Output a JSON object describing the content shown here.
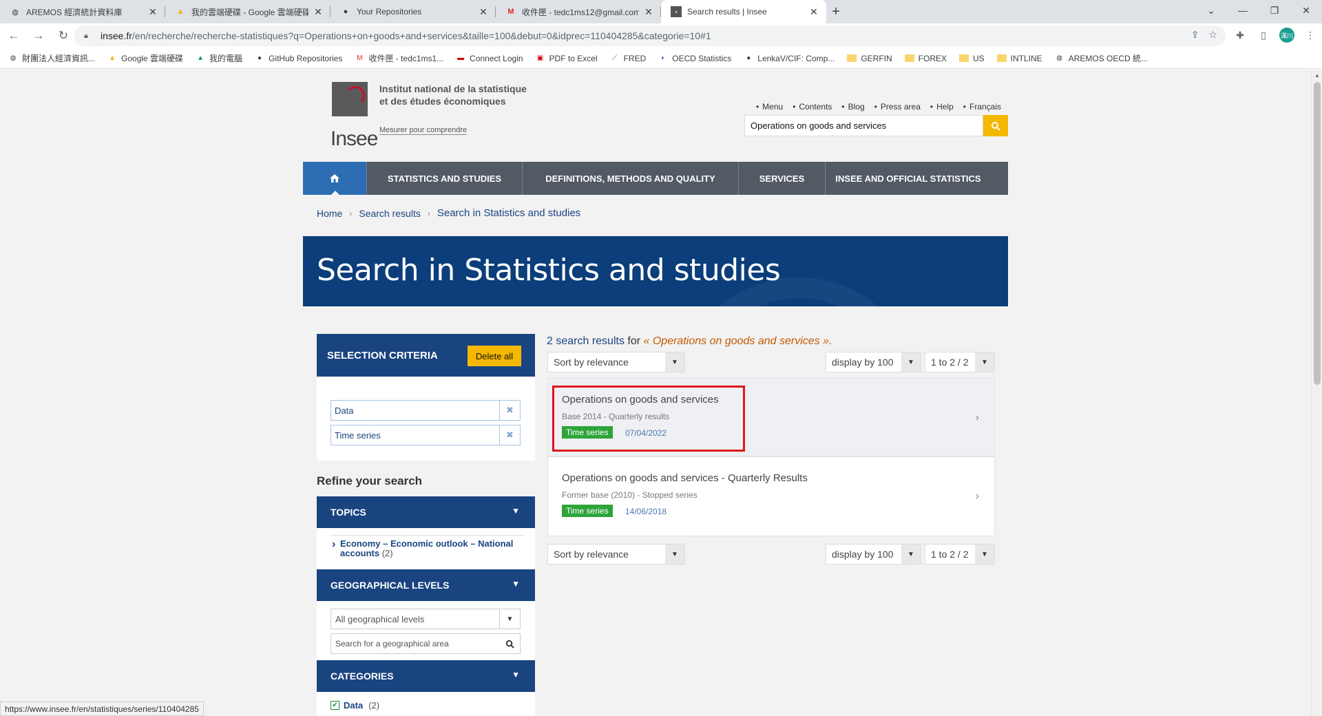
{
  "browser": {
    "tabs": [
      {
        "title": "AREMOS 經濟統計資料庫",
        "icon": "globe-icon",
        "active": false
      },
      {
        "title": "我的雲端硬碟 - Google 雲端硬碟",
        "icon": "google-drive-icon",
        "active": false
      },
      {
        "title": "Your Repositories",
        "icon": "github-icon",
        "active": false
      },
      {
        "title": "收件匣 - tedc1ms12@gmail.com",
        "icon": "gmail-icon",
        "active": false
      },
      {
        "title": "Search results | Insee",
        "icon": "insee-icon",
        "active": true
      }
    ],
    "url_host": "insee.fr",
    "url_path": "/en/recherche/recherche-statistiques?q=Operations+on+goods+and+services&taille=100&debut=0&idprec=110404285&categorie=10#1",
    "profile_initials": "滿川",
    "bookmarks": [
      {
        "label": "財團法人經濟資訊...",
        "icon": "globe-icon"
      },
      {
        "label": "Google 雲端硬碟",
        "icon": "google-drive-icon"
      },
      {
        "label": "我的電腦",
        "icon": "google-drive-icon"
      },
      {
        "label": "GitHub Repositories",
        "icon": "github-icon"
      },
      {
        "label": "收件匣 - tedc1ms1...",
        "icon": "gmail-icon"
      },
      {
        "label": "Connect Login",
        "icon": "flag-icon"
      },
      {
        "label": "PDF to Excel",
        "icon": "pdf-icon"
      },
      {
        "label": "FRED",
        "icon": "chart-icon"
      },
      {
        "label": "OECD Statistics",
        "icon": "oecd-icon"
      },
      {
        "label": "LenkaV/CIF: Comp...",
        "icon": "github-icon"
      },
      {
        "label": "GERFIN",
        "icon": "folder-icon"
      },
      {
        "label": "FOREX",
        "icon": "folder-icon"
      },
      {
        "label": "US",
        "icon": "folder-icon"
      },
      {
        "label": "INTLINE",
        "icon": "folder-icon"
      },
      {
        "label": "AREMOS OECD 統...",
        "icon": "globe-icon"
      }
    ],
    "status_url": "https://www.insee.fr/en/statistiques/series/110404285"
  },
  "header": {
    "logo_text": "Insee",
    "institute_line1": "Institut national de la statistique",
    "institute_line2": "et des études économiques",
    "tagline": "Mesurer pour comprendre",
    "top_links": [
      "Menu",
      "Contents",
      "Blog",
      "Press area",
      "Help",
      "Français"
    ],
    "search_value": "Operations on goods and services"
  },
  "nav": {
    "items": [
      "STATISTICS AND STUDIES",
      "DEFINITIONS, METHODS AND QUALITY",
      "SERVICES",
      "INSEE AND OFFICIAL STATISTICS"
    ]
  },
  "breadcrumb": {
    "home": "Home",
    "search_results": "Search results",
    "current": "Search in Statistics and studies"
  },
  "banner": {
    "title": "Search in Statistics and studies"
  },
  "criteria": {
    "title": "SELECTION CRITERIA",
    "delete_all": "Delete all",
    "chips": [
      "Data",
      "Time series"
    ]
  },
  "refine": {
    "title": "Refine your search",
    "topics": {
      "label": "TOPICS",
      "item": "Economy – Economic outlook – National accounts",
      "count": "(2)"
    },
    "geo": {
      "label": "GEOGRAPHICAL LEVELS",
      "select": "All geographical levels",
      "search_placeholder": "Search for a geographical area"
    },
    "categories": {
      "label": "CATEGORIES",
      "item": "Data",
      "count": "(2)"
    }
  },
  "results": {
    "count_text": "2 search results",
    "for_text": "for",
    "query_text": "« Operations on goods and services  ».",
    "sort": "Sort by relevance",
    "display": "display by 100",
    "range": "1 to 2 / 2",
    "items": [
      {
        "title": "Operations on goods and services",
        "subtitle": "Base 2014 - Quarterly results",
        "badge": "Time series",
        "date": "07/04/2022"
      },
      {
        "title": "Operations on goods and services - Quarterly Results",
        "subtitle": "Former base (2010) - Stopped series",
        "badge": "Time series",
        "date": "14/06/2018"
      }
    ]
  }
}
